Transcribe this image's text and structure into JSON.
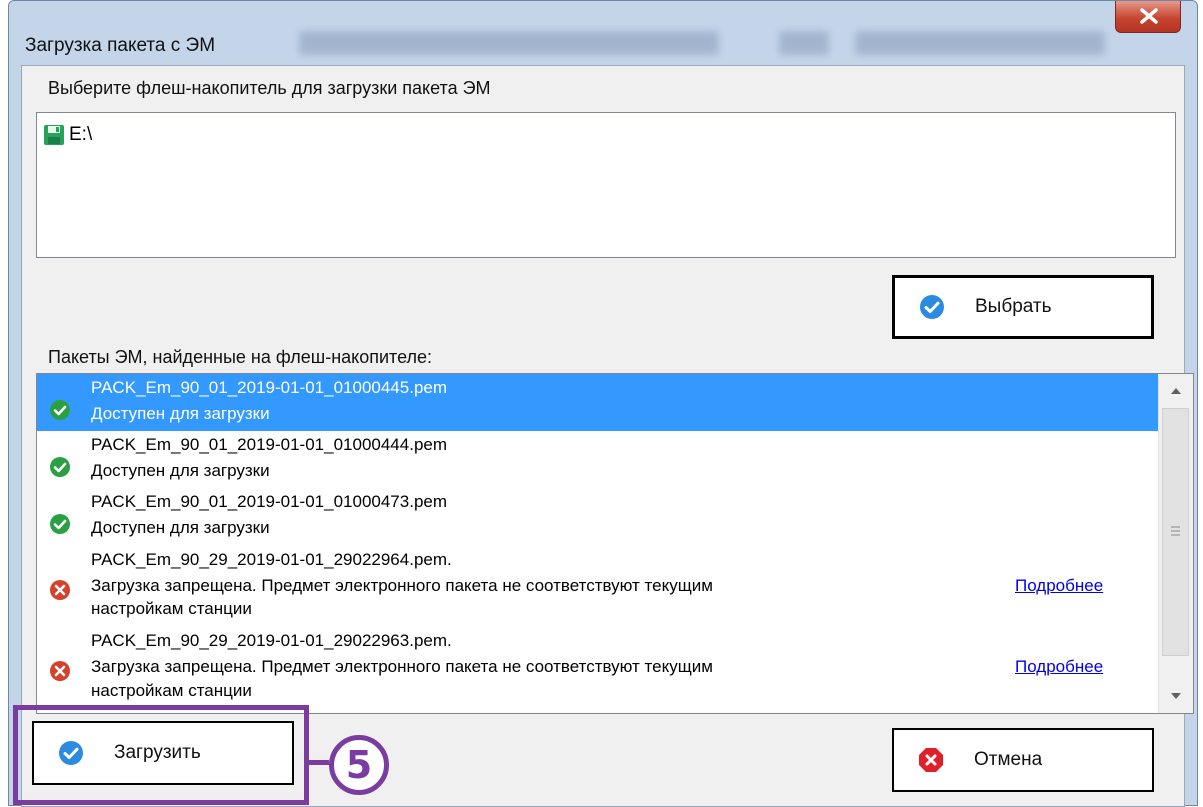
{
  "window": {
    "title": "Загрузка пакета с ЭМ",
    "close_icon": "close-icon"
  },
  "drive_section": {
    "label": "Выберите флеш-накопитель для загрузки пакета ЭМ",
    "drives": [
      {
        "label": "E:\\",
        "icon": "floppy-disk-icon"
      }
    ],
    "select_button_label": "Выбрать"
  },
  "packages_section": {
    "label": "Пакеты ЭМ, найденные на флеш-накопителе:",
    "items": [
      {
        "name": "PACK_Em_90_01_2019-01-01_01000445.pem",
        "status_line1": "Доступен для загрузки",
        "status_line2": "",
        "details_link": "",
        "state": "ok",
        "selected": true
      },
      {
        "name": "PACK_Em_90_01_2019-01-01_01000444.pem",
        "status_line1": "Доступен для загрузки",
        "status_line2": "",
        "details_link": "",
        "state": "ok",
        "selected": false
      },
      {
        "name": "PACK_Em_90_01_2019-01-01_01000473.pem",
        "status_line1": "Доступен для загрузки",
        "status_line2": "",
        "details_link": "",
        "state": "ok",
        "selected": false
      },
      {
        "name": "PACK_Em_90_29_2019-01-01_29022964.pem.",
        "status_line1": "Загрузка запрещена. Предмет электронного пакета не соответствуют текущим",
        "status_line2": "настройкам станции",
        "details_link": "Подробнее",
        "state": "error",
        "selected": false
      },
      {
        "name": "PACK_Em_90_29_2019-01-01_29022963.pem.",
        "status_line1": "Загрузка запрещена. Предмет электронного пакета не соответствуют текущим",
        "status_line2": "настройкам станции",
        "details_link": "Подробнее",
        "state": "error",
        "selected": false
      }
    ]
  },
  "footer": {
    "load_button_label": "Загрузить",
    "cancel_button_label": "Отмена"
  },
  "annotation": {
    "marker": "5",
    "color": "#7a3c9e"
  },
  "colors": {
    "selection": "#3399ff",
    "ok_icon": "#2aa043",
    "error_icon": "#d7402a",
    "check_button_icon": "#2b8be0",
    "link": "#0000ee"
  }
}
